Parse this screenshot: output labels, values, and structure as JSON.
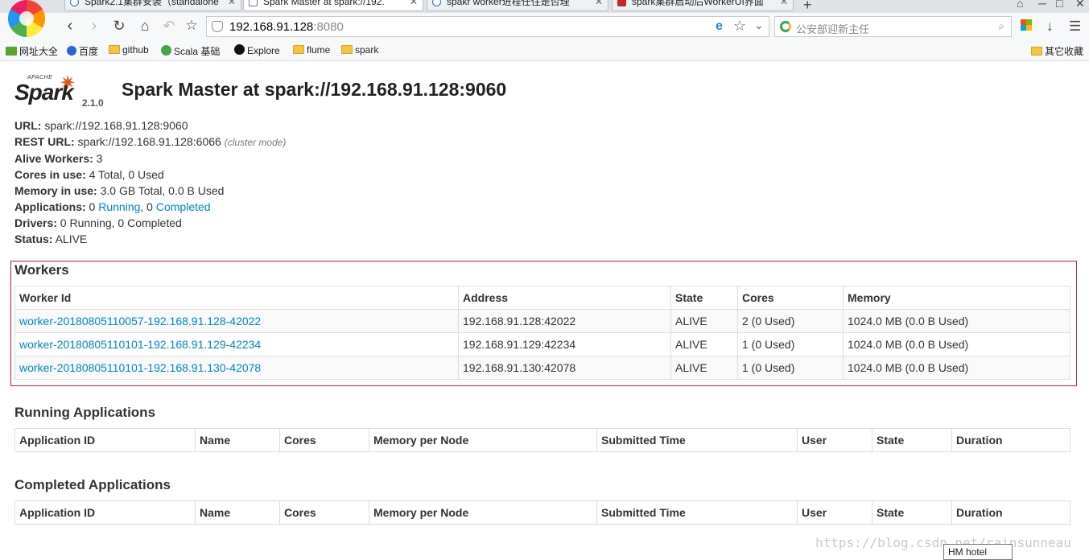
{
  "browser": {
    "tabs": [
      {
        "label": "Spark2.1集群安装（standalone"
      },
      {
        "label": "Spark Master at spark://192."
      },
      {
        "label": "spakr worker进程任住是否理"
      },
      {
        "label": "spark集群启动后WorkerUI界面"
      }
    ],
    "address": {
      "host": "192.168.91.128",
      "port": ":8080"
    },
    "search_placeholder": "公安部迎新主任",
    "bookmarks": [
      "网址大全",
      "百度",
      "github",
      "Scala 基础",
      "Explore",
      "flume",
      "spark"
    ],
    "other_bookmarks": "其它收藏"
  },
  "header": {
    "logo_apache": "APACHE",
    "logo_word": "Spark",
    "version": "2.1.0",
    "title": "Spark Master at spark://192.168.91.128:9060"
  },
  "info": {
    "url_label": "URL:",
    "url_value": " spark://192.168.91.128:9060",
    "rest_label": "REST URL:",
    "rest_value": " spark://192.168.91.128:6066 ",
    "rest_note": "(cluster mode)",
    "workers_label": "Alive Workers:",
    "workers_value": " 3",
    "cores_label": "Cores in use:",
    "cores_value": " 4 Total, 0 Used",
    "memory_label": "Memory in use:",
    "memory_value": " 3.0 GB Total, 0.0 B Used",
    "apps_label": "Applications:",
    "apps_prefix": " 0 ",
    "apps_running": "Running",
    "apps_mid": ", 0 ",
    "apps_completed": "Completed",
    "drivers_label": "Drivers:",
    "drivers_value": " 0 Running, 0 Completed",
    "status_label": "Status:",
    "status_value": " ALIVE"
  },
  "workers": {
    "title": "Workers",
    "columns": [
      "Worker Id",
      "Address",
      "State",
      "Cores",
      "Memory"
    ],
    "rows": [
      [
        "worker-20180805110057-192.168.91.128-42022",
        "192.168.91.128:42022",
        "ALIVE",
        "2 (0 Used)",
        "1024.0 MB (0.0 B Used)"
      ],
      [
        "worker-20180805110101-192.168.91.129-42234",
        "192.168.91.129:42234",
        "ALIVE",
        "1 (0 Used)",
        "1024.0 MB (0.0 B Used)"
      ],
      [
        "worker-20180805110101-192.168.91.130-42078",
        "192.168.91.130:42078",
        "ALIVE",
        "1 (0 Used)",
        "1024.0 MB (0.0 B Used)"
      ]
    ]
  },
  "running_apps": {
    "title": "Running Applications",
    "columns": [
      "Application ID",
      "Name",
      "Cores",
      "Memory per Node",
      "Submitted Time",
      "User",
      "State",
      "Duration"
    ]
  },
  "completed_apps": {
    "title": "Completed Applications",
    "columns": [
      "Application ID",
      "Name",
      "Cores",
      "Memory per Node",
      "Submitted Time",
      "User",
      "State",
      "Duration"
    ]
  },
  "watermark": "https://blog.csdn.net/rainsunneau",
  "tooltip": "HM hotel"
}
